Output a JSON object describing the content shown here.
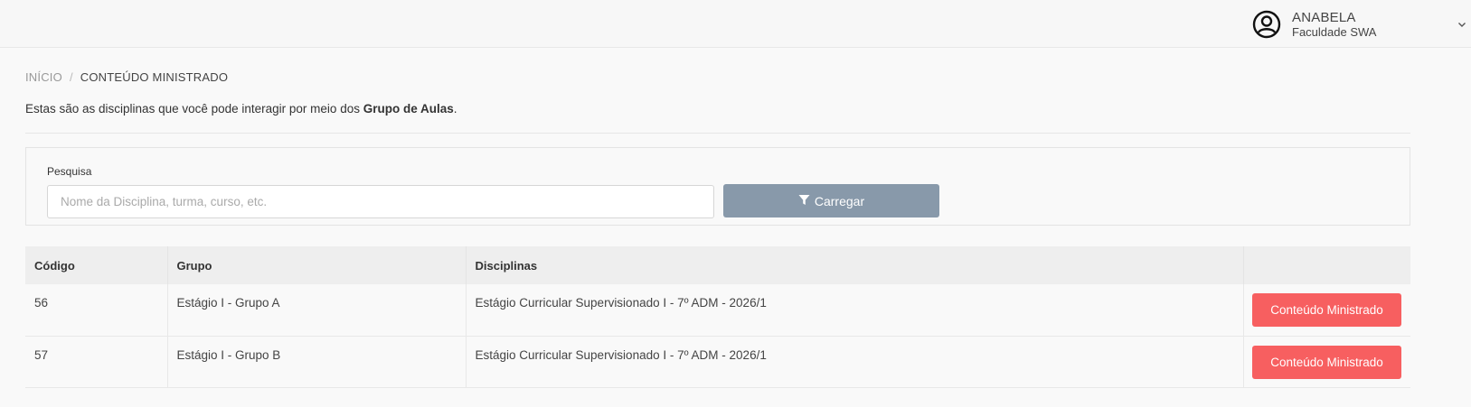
{
  "user": {
    "name": "ANABELA",
    "org": "Faculdade SWA"
  },
  "breadcrumb": {
    "home": "INÍCIO",
    "separator": "/",
    "current": "CONTEÚDO MINISTRADO"
  },
  "intro": {
    "prefix": "Estas são as disciplinas que você pode interagir por meio dos ",
    "bold": "Grupo de Aulas",
    "suffix": "."
  },
  "search": {
    "label": "Pesquisa",
    "placeholder": "Nome da Disciplina, turma, curso, etc.",
    "value": "",
    "button_label": "Carregar"
  },
  "table": {
    "headers": [
      "Código",
      "Grupo",
      "Disciplinas",
      ""
    ],
    "rows": [
      {
        "codigo": "56",
        "grupo": "Estágio I - Grupo A",
        "disciplina": "Estágio Curricular Supervisionado I - 7º ADM - 2026/1",
        "action": "Conteúdo Ministrado"
      },
      {
        "codigo": "57",
        "grupo": "Estágio I - Grupo B",
        "disciplina": "Estágio Curricular Supervisionado I - 7º ADM - 2026/1",
        "action": "Conteúdo Ministrado"
      }
    ]
  },
  "colors": {
    "load_button": "#8899aa",
    "action_button": "#f75f60"
  },
  "icons": {
    "avatar": "user-circle-icon",
    "dropdown": "chevron-down-icon",
    "filter": "filter-icon"
  }
}
